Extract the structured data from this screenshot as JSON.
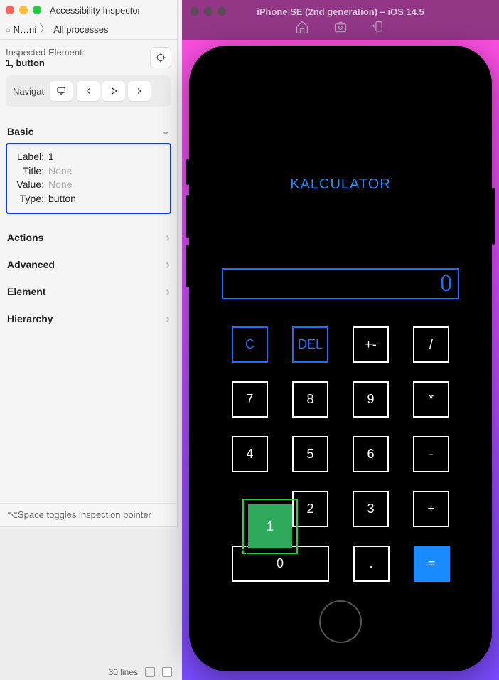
{
  "inspector": {
    "title": "Accessibility Inspector",
    "breadcrumb": {
      "app": "N…ni",
      "process": "All processes"
    },
    "inspected": {
      "label": "Inspected Element:",
      "value": "1, button"
    },
    "nav_label": "Navigat",
    "basic": {
      "header": "Basic",
      "rows": [
        {
          "k": "Label:",
          "v": "1",
          "none": false
        },
        {
          "k": "Title:",
          "v": "None",
          "none": true
        },
        {
          "k": "Value:",
          "v": "None",
          "none": true
        },
        {
          "k": "Type:",
          "v": "button",
          "none": false
        }
      ]
    },
    "sections": [
      "Actions",
      "Advanced",
      "Element",
      "Hierarchy"
    ],
    "footer": "⌥Space toggles inspection pointer",
    "status_lines": "30 lines"
  },
  "simulator": {
    "title": "iPhone SE (2nd generation) – iOS 14.5",
    "app": {
      "title": "KALCULATOR",
      "display": "0",
      "keys": {
        "r1": [
          "C",
          "DEL",
          "+-",
          "/"
        ],
        "r2": [
          "7",
          "8",
          "9",
          "*"
        ],
        "r3": [
          "4",
          "5",
          "6",
          "-"
        ],
        "r4": [
          "1",
          "2",
          "3",
          "+"
        ],
        "zero": "0",
        "dot": ".",
        "eq": "="
      }
    }
  }
}
